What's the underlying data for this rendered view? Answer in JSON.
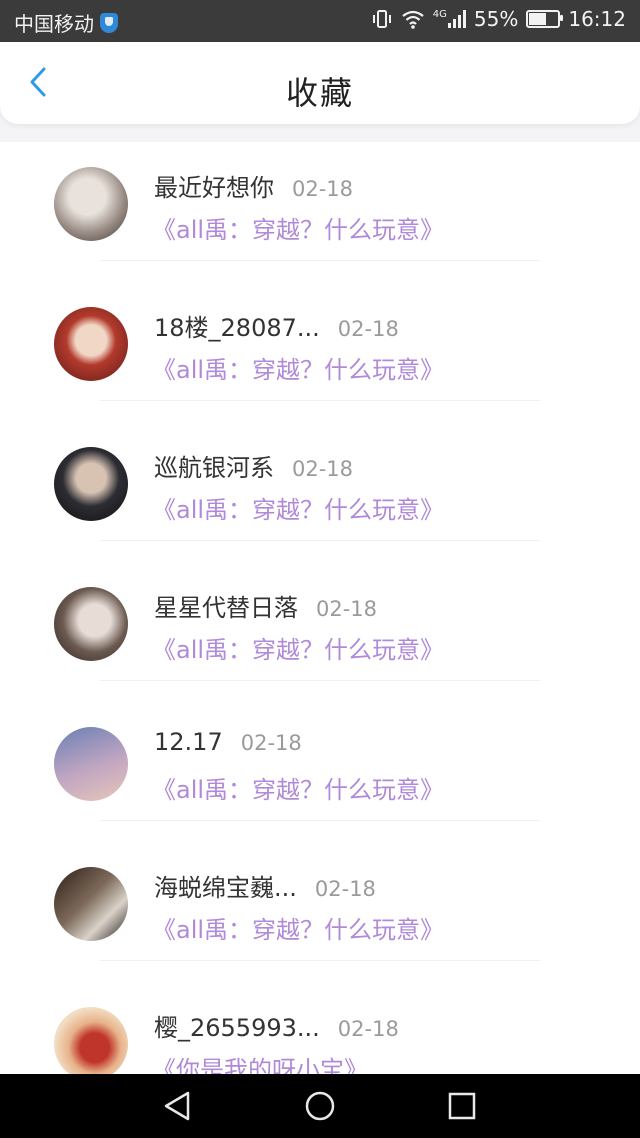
{
  "status_bar": {
    "carrier": "中国移动",
    "network": "4G",
    "battery": "55%",
    "battery_level": 0.55,
    "time": "16:12"
  },
  "header": {
    "title": "收藏",
    "back_icon": "chevron-left-icon"
  },
  "favorites": [
    {
      "name": "最近好想你",
      "date": "02-18",
      "work": "《all禹：穿越？什么玩意》"
    },
    {
      "name": "18楼_28087...",
      "date": "02-18",
      "work": "《all禹：穿越？什么玩意》"
    },
    {
      "name": "巡航银河系",
      "date": "02-18",
      "work": "《all禹：穿越？什么玩意》"
    },
    {
      "name": "星星代替日落",
      "date": "02-18",
      "work": "《all禹：穿越？什么玩意》"
    },
    {
      "name": "12.17",
      "date": "02-18",
      "work": "《all禹：穿越？什么玩意》"
    },
    {
      "name": "海蜕绵宝巍...",
      "date": "02-18",
      "work": "《all禹：穿越？什么玩意》"
    },
    {
      "name": "樱_2655993...",
      "date": "02-18",
      "work": "《你是我的呀小宝》"
    }
  ],
  "nav_bar": {
    "icons": [
      "back-triangle-icon",
      "home-circle-icon",
      "recents-square-icon"
    ]
  },
  "colors": {
    "accent": "#2f9be6",
    "work_title": "#b08ad8"
  }
}
